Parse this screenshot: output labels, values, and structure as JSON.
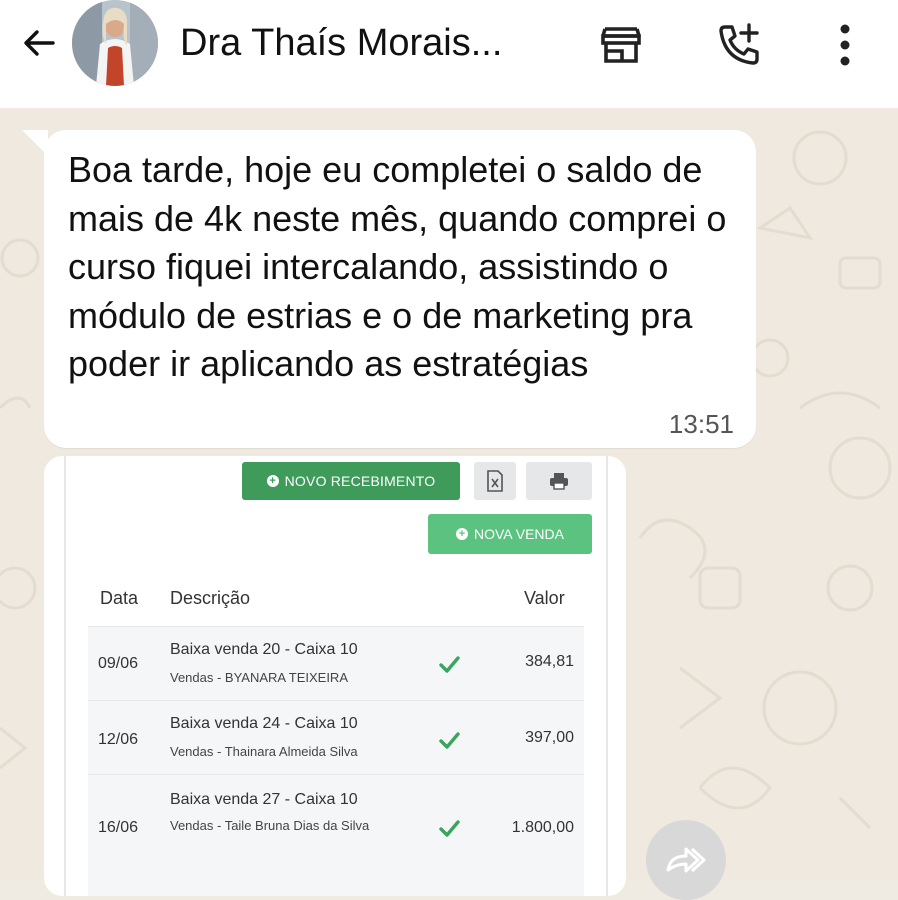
{
  "header": {
    "contact_name": "Dra Thaís Morais...",
    "icons": [
      "back-arrow-icon",
      "avatar",
      "storefront-icon",
      "add-call-icon",
      "more-vert-icon"
    ]
  },
  "message": {
    "text": "Boa tarde, hoje eu completei o saldo de mais de 4k neste mês, quando comprei o curso fiquei intercalando, assistindo o módulo de estrias e o de marketing pra poder ir aplicando as estratégias",
    "time": "13:51"
  },
  "attachment": {
    "buttons": {
      "novo_recebimento": "NOVO RECEBIMENTO",
      "nova_venda": "NOVA VENDA"
    },
    "table": {
      "headers": [
        "Data",
        "Descrição",
        "Valor"
      ],
      "rows": [
        {
          "date": "09/06",
          "title": "Baixa venda 20 - Caixa 10",
          "subtitle": "Vendas - BYANARA TEIXEIRA",
          "value": "384,81"
        },
        {
          "date": "12/06",
          "title": "Baixa venda 24 - Caixa 10",
          "subtitle": "Vendas - Thainara Almeida Silva",
          "value": "397,00"
        },
        {
          "date": "16/06",
          "title": "Baixa venda 27 - Caixa 10",
          "subtitle": "Vendas - Taile Bruna Dias da Silva",
          "value": "1.800,00"
        }
      ]
    }
  },
  "colors": {
    "wallpaper": "#efe9e0",
    "bubble": "#ffffff",
    "button_green": "#3e9b5a",
    "button_light_green": "#5cc280",
    "check_green": "#3aa55c"
  }
}
